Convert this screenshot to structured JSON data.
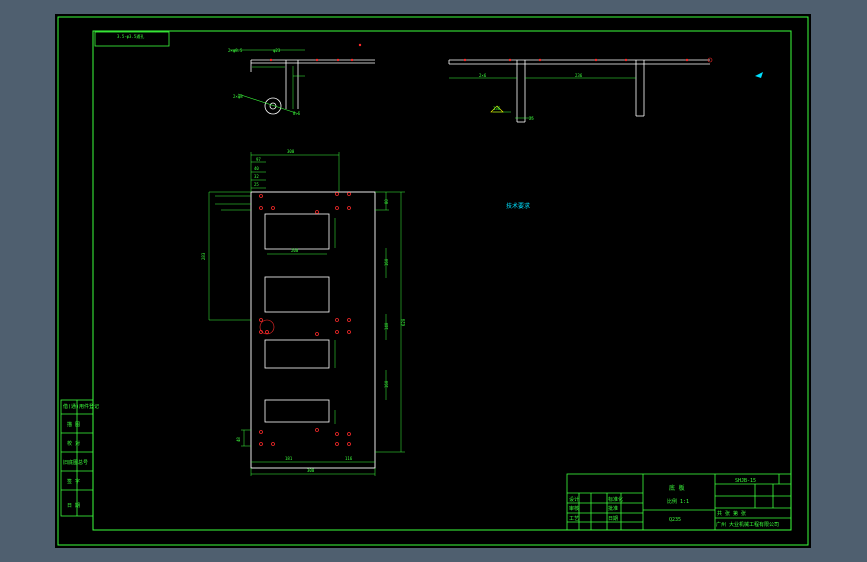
{
  "drawing": {
    "callout_box_text": "3.5-φ3.5通孔",
    "note_text": "技术要求",
    "detail_labels": [
      "2×φ8.5",
      "φ23",
      "2×φ8",
      "8.5"
    ],
    "section_labels": [
      "2×6",
      "236",
      "136",
      "25"
    ],
    "plan_dims": {
      "top_overall": "300",
      "top_small": "97",
      "left_steps": [
        "40",
        "32",
        "25"
      ],
      "left_overall": "283",
      "inner_width": "200",
      "right_overall": "620",
      "right_steps": [
        "80",
        "160",
        "140",
        "160"
      ],
      "bottom_left": "181",
      "bottom_right": "116",
      "bottom_overall": "300",
      "left_lower": "48"
    }
  },
  "left_strip": {
    "rows": [
      "借(通)用件登记",
      "描 图",
      "校 对",
      "旧底图总号",
      "签 字",
      "日 期"
    ]
  },
  "title_block": {
    "drawing_no": "SHJB-15",
    "part_name": "底 板",
    "scale": "比例 1:1",
    "material": "Q235",
    "sheet": "共 张 第 张",
    "company": "广州 大业机械工程有限公司",
    "designer": "设计",
    "checker": "审核",
    "process": "工艺",
    "std": "标准化",
    "approve": "批准",
    "date": "日期"
  },
  "colors": {
    "background": "#000000",
    "frame": "#3cff3c",
    "geometry": "#ffffff",
    "dimension": "#3cff3c",
    "holes": "#ff2a2a",
    "highlight": "#00e0ff",
    "outer": "#4f5f6f"
  }
}
